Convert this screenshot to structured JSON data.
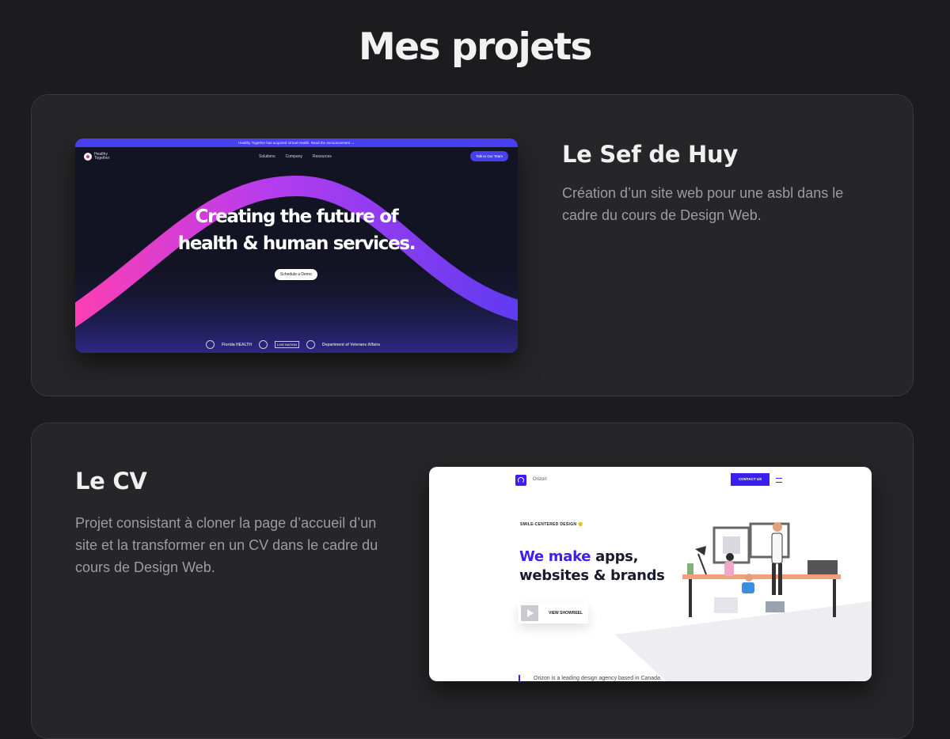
{
  "page": {
    "title": "Mes projets"
  },
  "projects": [
    {
      "title": "Le Sef de Huy",
      "description": "Création d’un site web pour une asbl dans le cadre du cours de Design Web.",
      "preview": {
        "announcement": "Healthy Together has acquired Virtual Health. Read the announcement →",
        "logo_text": "Healthy Together",
        "nav": [
          "Solutions",
          "Company",
          "Resources"
        ],
        "cta": "Talk to Our Team",
        "headline_line1": "Creating the future of",
        "headline_line2": "health & human services.",
        "demo_button": "Schedule a Demo",
        "partner_logos": [
          "Florida HEALTH",
          "LIVE NATION",
          "Department of Veterans Affairs"
        ],
        "colors": {
          "accent": "#4840f0",
          "background": "#121424",
          "wave_start": "#ff3fb0",
          "wave_end": "#5b3bf0"
        }
      }
    },
    {
      "title": "Le CV",
      "description": "Projet consistant à cloner la page d’accueil d’un site et la transformer en un CV dans le cadre du cours de Design Web.",
      "preview": {
        "brand": "Orizon",
        "contact": "CONTACT US",
        "eyebrow": "SMILE-CENTERED DESIGN 😊",
        "headline_accent": "We make",
        "headline_rest1": " apps,",
        "headline_line2": "websites & brands",
        "showreel": "VIEW SHOWREEL",
        "bottom_text": "Orizon is a leading design agency based in Canada.",
        "colors": {
          "accent": "#3b1ef0",
          "background": "#ffffff"
        }
      }
    }
  ]
}
